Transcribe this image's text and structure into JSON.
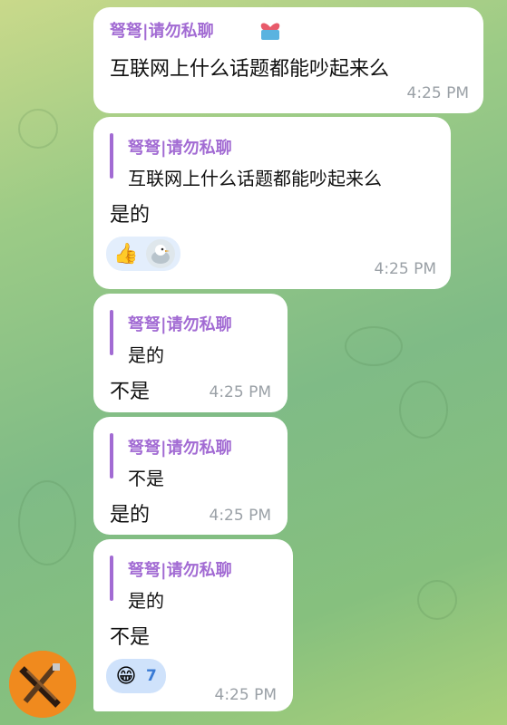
{
  "messages": [
    {
      "sender": "弩弩|请勿私聊",
      "sender_icon": "heart-box-icon",
      "text": "互联网上什么话题都能吵起来么",
      "time": "4:25 PM"
    },
    {
      "reply": {
        "sender": "弩弩|请勿私聊",
        "text": "互联网上什么话题都能吵起来么"
      },
      "text": "是的",
      "reactions": [
        "👍"
      ],
      "reactor_avatar": "bird-avatar-icon",
      "time": "4:25 PM"
    },
    {
      "reply": {
        "sender": "弩弩|请勿私聊",
        "text": "是的"
      },
      "text": "不是",
      "time": "4:25 PM"
    },
    {
      "reply": {
        "sender": "弩弩|请勿私聊",
        "text": "不是"
      },
      "text": "是的",
      "time": "4:25 PM"
    },
    {
      "reply": {
        "sender": "弩弩|请勿私聊",
        "text": "是的"
      },
      "text": "不是",
      "reaction": {
        "emoji": "😁",
        "count": "7"
      },
      "time": "4:25 PM"
    }
  ],
  "colors": {
    "sender": "#a26bd3",
    "time": "#9aa0a6",
    "reaction_bg": "#e3eefc"
  },
  "avatar": "pixel-crossbow-avatar"
}
